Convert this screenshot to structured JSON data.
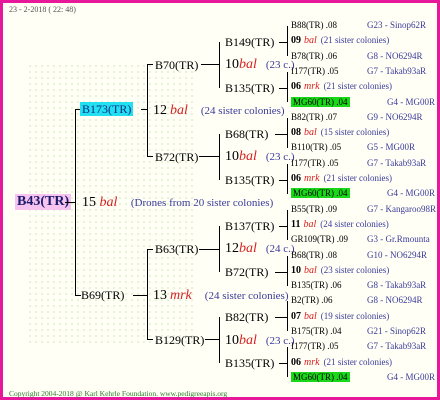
{
  "header": "23 - 2-2018 ( 22: 48)",
  "footer": "Copyright 2004-2018 @ Karl Kehrle Foundation.   www.pedigreeapis.org",
  "root": {
    "label": "B43(TR)",
    "num": "15",
    "race": "bal",
    "note": "(Drones from 20 sister colonies)"
  },
  "sire": {
    "label": "B173(TR)",
    "num": "12",
    "race": "bal",
    "note": "(24 sister colonies)"
  },
  "dam": {
    "label": "B69(TR)",
    "num": "13",
    "race": "mrk",
    "note": "(24 sister colonies)"
  },
  "g2": [
    {
      "label": "B70(TR)"
    },
    {
      "label": "B72(TR)"
    },
    {
      "label": "B63(TR)"
    },
    {
      "label": "B129(TR)"
    }
  ],
  "g3": [
    {
      "label": "B149(TR)",
      "num": "10",
      "race": "bal",
      "note": "(23 c.)"
    },
    {
      "label": "B135(TR)"
    },
    {
      "label": "B68(TR)",
      "num": "10",
      "race": "bal",
      "note": "(23 c.)"
    },
    {
      "label": "B135(TR)"
    },
    {
      "label": "B137(TR)",
      "num": "12",
      "race": "bal",
      "note": "(24 c.)"
    },
    {
      "label": "B72(TR)"
    },
    {
      "label": "B82(TR)",
      "num": "10",
      "race": "bal",
      "note": "(23 c.)"
    },
    {
      "label": "B135(TR)"
    }
  ],
  "leaves": [
    {
      "a": "B88(TR) .08",
      "b": "G23 - Sinop62R"
    },
    {
      "n": "09",
      "race": "bal",
      "note": "(21 sister colonies)"
    },
    {
      "a": "B78(TR) .06",
      "b": "G8 - NO6294R"
    },
    {
      "a": "I177(TR) .05",
      "b": "G7 - Takab93aR"
    },
    {
      "n": "06",
      "race": "mrk",
      "note": "(21 sister colonies)"
    },
    {
      "a": "MG60(TR) .04",
      "b": "G4 - MG00R",
      "green": true
    },
    {
      "a": "B82(TR) .07",
      "b": "G9 - NO6294R"
    },
    {
      "n": "08",
      "race": "bal",
      "note": "(15 sister colonies)"
    },
    {
      "a": "B110(TR) .05",
      "b": "G5 - MG00R"
    },
    {
      "a": "I177(TR) .05",
      "b": "G7 - Takab93aR"
    },
    {
      "n": "06",
      "race": "mrk",
      "note": "(21 sister colonies)"
    },
    {
      "a": "MG60(TR) .04",
      "b": "G4 - MG00R",
      "green": true
    },
    {
      "a": "B55(TR) .09",
      "b": "G7 - Kangaroo98R"
    },
    {
      "n": "11",
      "race": "bal",
      "note": "(24 sister colonies)"
    },
    {
      "a": "GR109(TR) .09",
      "b": "G3 - Gr.Rmounta"
    },
    {
      "a": "B68(TR) .08",
      "b": "G10 - NO6294R"
    },
    {
      "n": "10",
      "race": "bal",
      "note": "(23 sister colonies)"
    },
    {
      "a": "B135(TR) .06",
      "b": "G8 - Takab93aR"
    },
    {
      "a": "B2(TR) .06",
      "b": "G8 - NO6294R"
    },
    {
      "n": "07",
      "race": "bal",
      "note": "(19 sister colonies)"
    },
    {
      "a": "B175(TR) .04",
      "b": "G21 - Sinop62R"
    },
    {
      "a": "I177(TR) .05",
      "b": "G7 - Takab93aR"
    },
    {
      "n": "06",
      "race": "mrk",
      "note": "(21 sister colonies)"
    },
    {
      "a": "MG60(TR) .04",
      "b": "G4 - MG00R",
      "green": true
    }
  ]
}
